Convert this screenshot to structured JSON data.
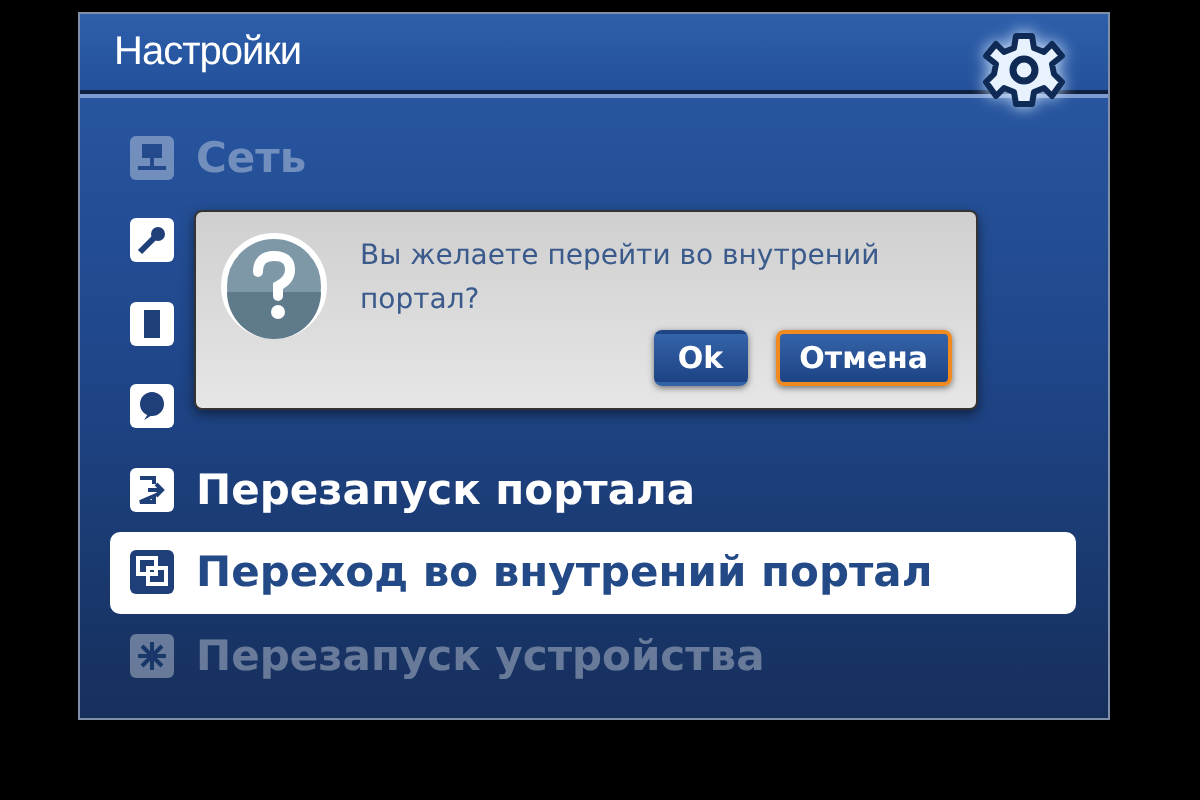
{
  "header": {
    "title": "Настройки"
  },
  "menu": [
    {
      "label": "Сеть",
      "selected": false,
      "dimmed": true
    },
    {
      "selected": false,
      "dimmed": false
    },
    {
      "selected": false,
      "dimmed": false
    },
    {
      "selected": false,
      "dimmed": false
    },
    {
      "label": "Перезапуск портала",
      "selected": false,
      "dimmed": false
    },
    {
      "label": "Переход во внутрений портал",
      "selected": true,
      "dimmed": false
    },
    {
      "label": "Перезапуск устройства",
      "selected": false,
      "dimmed": true
    }
  ],
  "dialog": {
    "message": "Вы желаете перейти во внутрений портал?",
    "buttons": [
      {
        "label": "Ok",
        "focused": false
      },
      {
        "label": "Отмена",
        "focused": true
      }
    ]
  }
}
